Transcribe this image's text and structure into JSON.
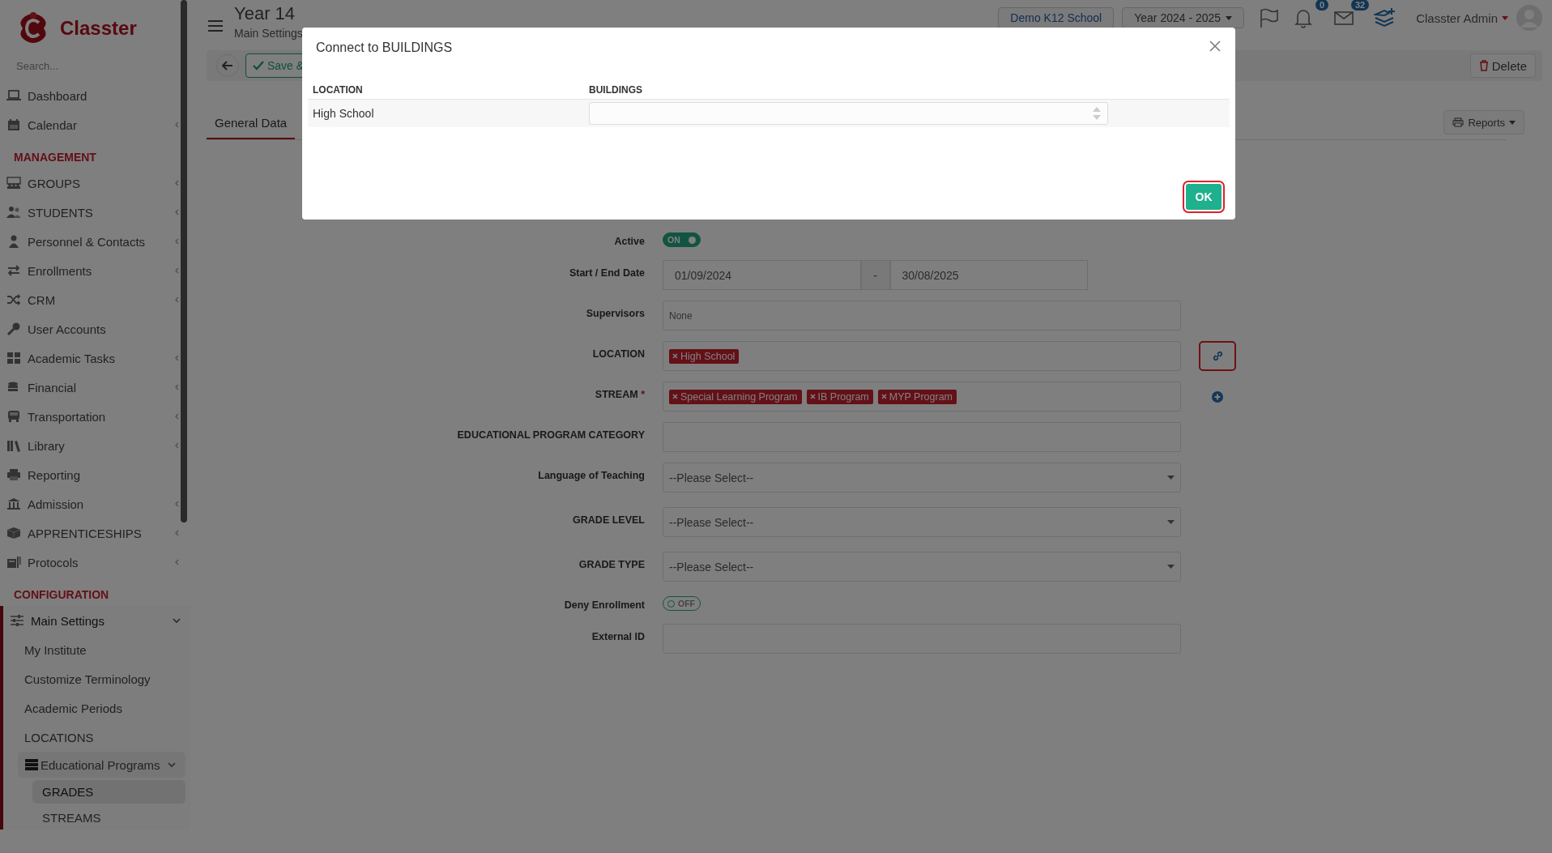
{
  "sidebar": {
    "logo": "Classter",
    "search": {
      "placeholder": "Search..."
    },
    "sections": [
      {
        "items": [
          {
            "label": "Dashboard",
            "kind": "link"
          },
          {
            "label": "Calendar",
            "kind": "submenu",
            "expanded": false
          }
        ]
      },
      {
        "heading": "MANAGEMENT",
        "items": [
          {
            "label": "GROUPS",
            "kind": "submenu",
            "expanded": false
          },
          {
            "label": "STUDENTS",
            "kind": "submenu",
            "expanded": false
          },
          {
            "label": "Personnel & Contacts",
            "kind": "submenu",
            "expanded": false
          },
          {
            "label": "Enrollments",
            "kind": "submenu",
            "expanded": false
          },
          {
            "label": "CRM",
            "kind": "submenu",
            "expanded": false
          },
          {
            "label": "User Accounts",
            "kind": "link"
          },
          {
            "label": "Academic Tasks",
            "kind": "submenu",
            "expanded": false
          },
          {
            "label": "Financial",
            "kind": "submenu",
            "expanded": false
          },
          {
            "label": "Transportation",
            "kind": "submenu",
            "expanded": false
          },
          {
            "label": "Library",
            "kind": "submenu",
            "expanded": false
          },
          {
            "label": "Reporting",
            "kind": "link"
          },
          {
            "label": "Admission",
            "kind": "submenu",
            "expanded": false
          },
          {
            "label": "APPRENTICESHIPS",
            "kind": "submenu",
            "expanded": false
          },
          {
            "label": "Protocols",
            "kind": "submenu",
            "expanded": false
          }
        ]
      },
      {
        "heading": "CONFIGURATION",
        "items": [
          {
            "label": "Main Settings",
            "kind": "submenu",
            "expanded": true,
            "children": [
              {
                "label": "My Institute",
                "kind": "sublink",
                "selected": false
              },
              {
                "label": "Customize Terminology",
                "kind": "sublink",
                "selected": false
              },
              {
                "label": "Academic Periods",
                "kind": "sublink",
                "selected": false
              },
              {
                "label": "LOCATIONS",
                "kind": "sublink",
                "selected": false
              },
              {
                "label": "Educational Programs",
                "kind": "subgroup",
                "expanded": true,
                "children": [
                  {
                    "label": "GRADES",
                    "selected": true
                  },
                  {
                    "label": "STREAMS",
                    "selected": false
                  }
                ]
              }
            ]
          }
        ]
      }
    ]
  },
  "header": {
    "title": "Year 14",
    "subtitle": "Main Settings",
    "school": "Demo K12 School",
    "year": "Year 2024 - 2025",
    "notifications": "0",
    "messages": "32",
    "user": "Classter Admin"
  },
  "toolbar": {
    "save": "Save &",
    "delete": "Delete"
  },
  "tabs": [
    {
      "label": "General Data",
      "selected": true
    }
  ],
  "reports": "Reports",
  "form": [
    {
      "kind": "toggle",
      "label": "Active",
      "on": true,
      "text": "ON"
    },
    {
      "kind": "daterange",
      "label": "Start / End Date",
      "start": "01/09/2024",
      "separator": "-",
      "end": "30/08/2025"
    },
    {
      "kind": "text",
      "label": "Supervisors",
      "value": "None"
    },
    {
      "kind": "tags",
      "label": "LOCATION",
      "tags": [
        "High School"
      ],
      "action": {
        "kind": "connect",
        "highlighted": true
      }
    },
    {
      "kind": "tags",
      "label": "STREAM",
      "required_mark": "*",
      "tags": [
        "Special Learning Program",
        "IB Program",
        "MYP Program"
      ],
      "action": {
        "kind": "add",
        "highlighted": false
      }
    },
    {
      "kind": "text",
      "label": "EDUCATIONAL PROGRAM CATEGORY"
    },
    {
      "kind": "select",
      "label": "Language of Teaching",
      "value": "--Please Select--"
    },
    {
      "kind": "select",
      "label": "GRADE LEVEL",
      "value": "--Please Select--"
    },
    {
      "kind": "select",
      "label": "GRADE TYPE",
      "value": "--Please Select--"
    },
    {
      "kind": "toggle",
      "label": "Deny Enrollment",
      "on": false,
      "text": "OFF"
    },
    {
      "kind": "text",
      "label": "External ID"
    }
  ],
  "modal": {
    "title": "Connect to BUILDINGS",
    "columns": [
      "LOCATION",
      "BUILDINGS"
    ],
    "rows": [
      {
        "location": "High School"
      }
    ],
    "ok": {
      "label": "OK",
      "highlighted": true
    }
  }
}
